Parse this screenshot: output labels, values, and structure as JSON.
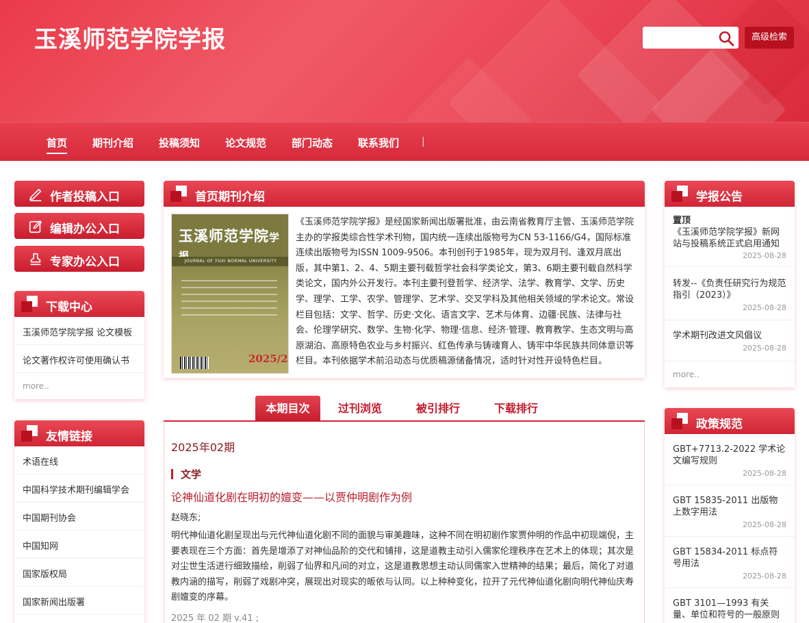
{
  "header": {
    "title": "玉溪师范学院学报",
    "search_placeholder": "",
    "advanced_search": "高级检索"
  },
  "nav": [
    "首页",
    "期刊介绍",
    "投稿须知",
    "论文规范",
    "部门动态",
    "联系我们"
  ],
  "nav_separator": "|",
  "entries": [
    "作者投稿入口",
    "编辑办公入口",
    "专家办公入口"
  ],
  "downloads": {
    "title": "下载中心",
    "items": [
      "玉溪师范学院学报 论文模板",
      "论文著作权许可使用确认书"
    ],
    "more": "more.."
  },
  "links": {
    "title": "友情链接",
    "items": [
      "术语在线",
      "中国科学技术期刊编辑学会",
      "中国期刊协会",
      "中国知网",
      "国家版权局",
      "国家新闻出版署"
    ]
  },
  "intro": {
    "title": "首页期刊介绍",
    "text": "《玉溪师范学院学报》是经国家新闻出版署批准，由云南省教育厅主管、玉溪师范学院主办的学报类综合性学术刊物，国内统一连续出版物号为CN 53-1166/G4，国际标准连续出版物号为ISSN 1009-9506。本刊创刊于1985年，现为双月刊、逢双月底出版，其中第1、2、4、5期主要刊载哲学社会科学类论文，第3、6期主要刊载自然科学类论文，国内外公开发行。本刊主要刊登哲学、经济学、法学、教育学、文学、历史学、理学、工学、农学、管理学、艺术学、交叉学科及其他相关领域的学术论文。常设栏目包括：文学、哲学、历史·文化、语言文字、艺术与体育、边疆·民族、法律与社会、伦理学研究、数学、生物·化学、物理·信息、经济·管理、教育教学、生态文明与高原湖泊、高原特色农业与乡村振兴、红色传承与铸魂育人、铸牢中华民族共同体意识等栏目。本刊依据学术前沿动态与优质稿源储备情况，适时针对性开设特色栏目。",
    "cover": {
      "title_main": "玉溪师范学院",
      "title_tail": "学报",
      "subtitle": "JOURNAL OF YUXI NORMAL UNIVERSITY",
      "issue": "2025/2"
    }
  },
  "tabs": [
    "本期目次",
    "过刊浏览",
    "被引排行",
    "下载排行"
  ],
  "current_issue": {
    "issue": "2025年02期",
    "section": "文学",
    "article_title": "论神仙道化剧在明初的嬗变——以贾仲明剧作为例",
    "author": "赵晓东;",
    "abstract": "明代神仙道化剧呈现出与元代神仙道化剧不同的面貌与审美趣味，这种不同在明初剧作家贾仲明的作品中初现端倪，主要表现在三个方面：首先是增添了对神仙品阶的交代和铺排，这是道教主动引入儒家伦理秩序在艺术上的体现；其次是对尘世生活进行细致描绘，削弱了仙界和凡间的对立，这是道教思想主动认同儒家入世精神的结果；最后，简化了对道教内涵的描写，削弱了戏剧冲突，展现出对现实的皈依与认同。以上种种变化，拉开了元代神仙道化剧向明代神仙庆寿剧嬗变的序幕。",
    "citation": "2025 年 02 期 v.41 ;"
  },
  "announcements": {
    "title": "学报公告",
    "pin_label": "置顶",
    "items": [
      {
        "title": "《玉溪师范学院学报》新网站与投稿系统正式启用通知",
        "date": "2025-08-28"
      },
      {
        "title": "转发--《负责任研究行为规范指引（2023）》",
        "date": "2025-08-28"
      },
      {
        "title": "学术期刊改进文风倡议",
        "date": "2025-08-28"
      }
    ],
    "more": "more.."
  },
  "policies": {
    "title": "政策规范",
    "items": [
      {
        "title": "GBT+7713.2-2022 学术论文编写规则",
        "date": "2025-08-28"
      },
      {
        "title": "GBT 15835-2011 出版物上数字用法",
        "date": "2025-08-28"
      },
      {
        "title": "GBT 15834-2011 标点符号用法",
        "date": "2025-08-28"
      },
      {
        "title": "GBT 3101—1993 有关量、单位和符号的一般原则",
        "date": ""
      }
    ]
  }
}
